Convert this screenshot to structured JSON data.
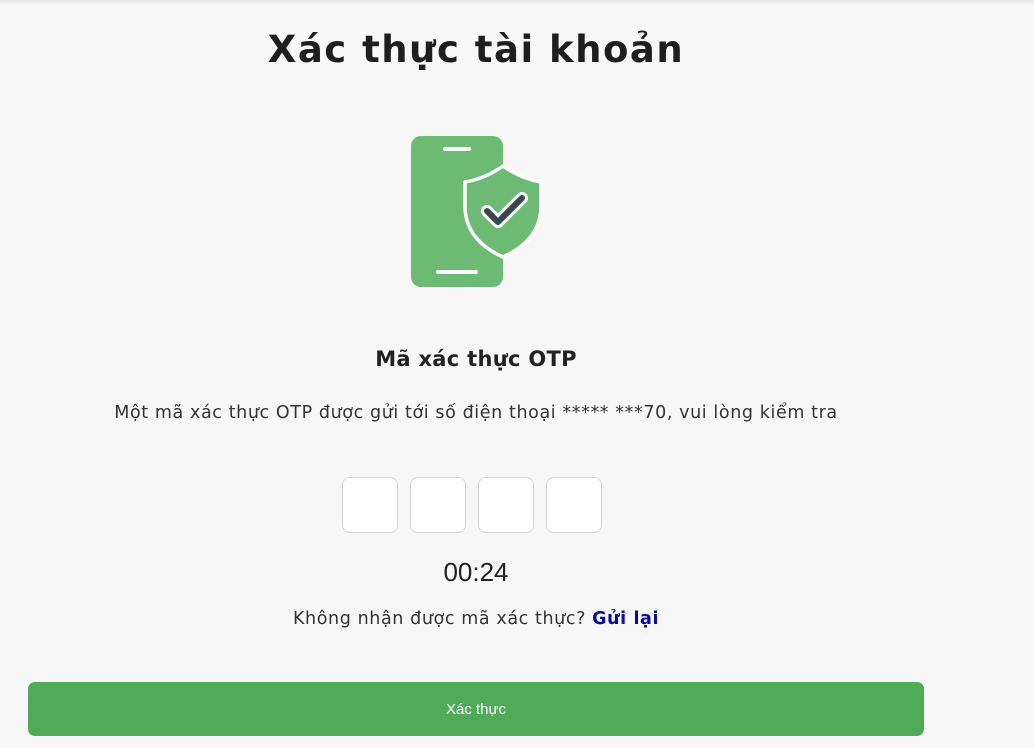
{
  "page": {
    "title": "Xác thực tài khoản"
  },
  "illustration": {
    "icon": "phone-shield-check-icon",
    "phone_color": "#6dba74",
    "shield_color": "#6dba74",
    "check_color": "#37474f"
  },
  "otp": {
    "heading": "Mã xác thực OTP",
    "description": "Một mã xác thực OTP được gửi tới số điện thoại ***** ***70, vui lòng kiểm tra",
    "inputs": [
      "",
      "",
      "",
      ""
    ],
    "timer": "00:24",
    "resend_prompt": "Không nhận được mã xác thực? ",
    "resend_link": "Gửi lại"
  },
  "actions": {
    "submit_label": "Xác thực",
    "submit_color": "#4fab57"
  }
}
